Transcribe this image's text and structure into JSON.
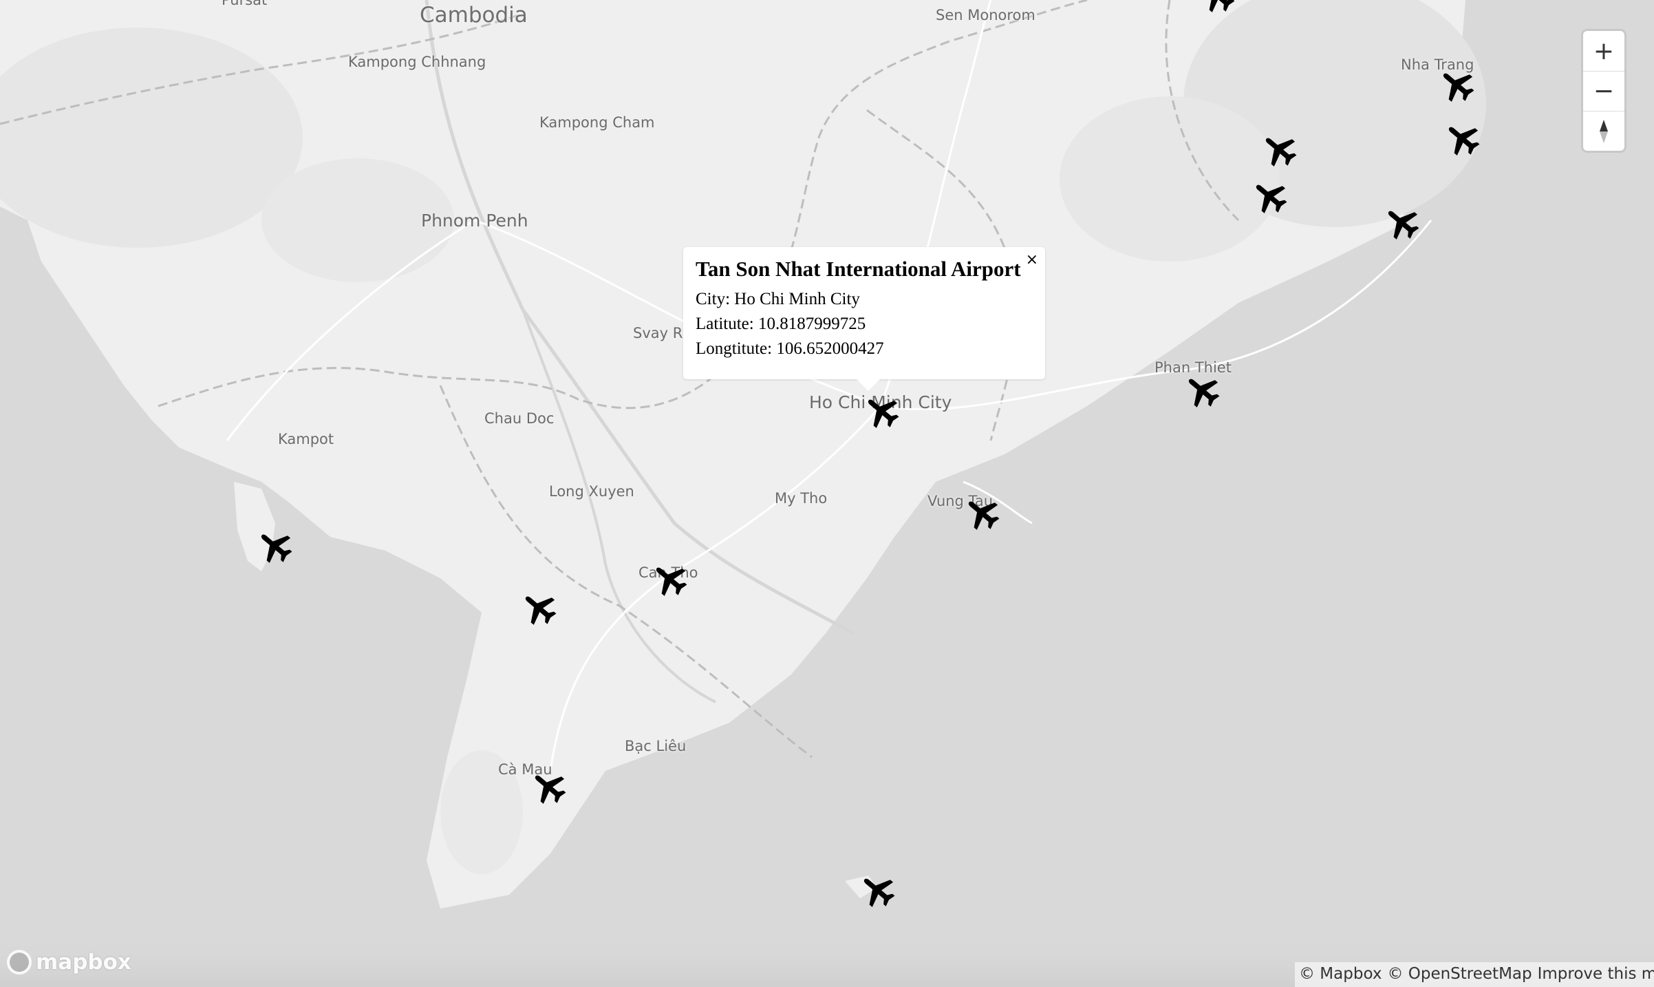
{
  "places": [
    {
      "name": "Pursat"
    },
    {
      "name": "Cambodia"
    },
    {
      "name": "Sen Monorom"
    },
    {
      "name": "Kampong Chhnang"
    },
    {
      "name": "Kampong Cham"
    },
    {
      "name": "Phnom Penh"
    },
    {
      "name": "Nha Trang"
    },
    {
      "name": "Svay Rieng"
    },
    {
      "name": "Ho Chi Minh City"
    },
    {
      "name": "Phan Thiet"
    },
    {
      "name": "Chau Doc"
    },
    {
      "name": "Kampot"
    },
    {
      "name": "Long Xuyen"
    },
    {
      "name": "My Tho"
    },
    {
      "name": "Vung Tau"
    },
    {
      "name": "Can Tho"
    },
    {
      "name": "Bạc Liêu"
    },
    {
      "name": "Cà Mau"
    }
  ],
  "markers": [
    {
      "icon": "airplane-icon",
      "lat": 10.8188,
      "lng": 106.652
    },
    {
      "icon": "airplane-icon"
    },
    {
      "icon": "airplane-icon"
    },
    {
      "icon": "airplane-icon"
    },
    {
      "icon": "airplane-icon"
    },
    {
      "icon": "airplane-icon"
    },
    {
      "icon": "airplane-icon"
    },
    {
      "icon": "airplane-icon"
    },
    {
      "icon": "airplane-icon"
    },
    {
      "icon": "airplane-icon"
    },
    {
      "icon": "airplane-icon"
    },
    {
      "icon": "airplane-icon"
    },
    {
      "icon": "airplane-icon"
    },
    {
      "icon": "airplane-icon"
    },
    {
      "icon": "airplane-icon"
    }
  ],
  "popup": {
    "title": "Tan Son Nhat International Airport",
    "city": "City: Ho Chi Minh City",
    "latitude": "Latitute: 10.8187999725",
    "longitude": "Longtitute: 106.652000427",
    "close": "×"
  },
  "controls": {
    "zoom_in": "+",
    "zoom_out": "−",
    "compass": "compass-icon"
  },
  "logo": {
    "text": "mapbox"
  },
  "attribution": {
    "mapbox": "© Mapbox",
    "osm": "© OpenStreetMap",
    "improve": "Improve this map"
  },
  "colors": {
    "sea": "#d9d9d9",
    "land": "#efefef",
    "border": "#bdbdbd",
    "road": "#ffffff",
    "marker": "#000000"
  }
}
